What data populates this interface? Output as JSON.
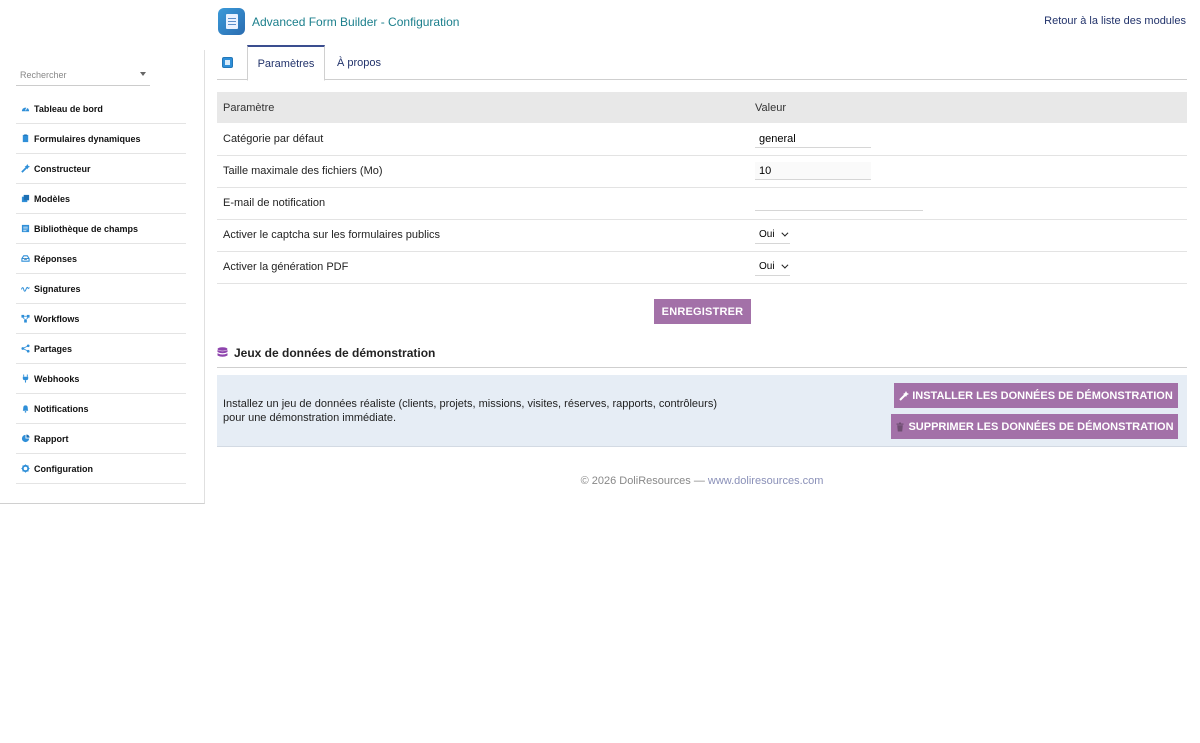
{
  "header": {
    "title": "Advanced Form Builder - Configuration",
    "back_link": "Retour à la liste des modules"
  },
  "sidebar": {
    "search_placeholder": "Rechercher",
    "items": [
      {
        "label": "Tableau de bord",
        "icon": "dashboard-icon"
      },
      {
        "label": "Formulaires dynamiques",
        "icon": "clipboard-icon"
      },
      {
        "label": "Constructeur",
        "icon": "magic-wand-icon"
      },
      {
        "label": "Modèles",
        "icon": "copy-icon"
      },
      {
        "label": "Bibliothèque de champs",
        "icon": "list-icon"
      },
      {
        "label": "Réponses",
        "icon": "inbox-icon"
      },
      {
        "label": "Signatures",
        "icon": "signature-icon"
      },
      {
        "label": "Workflows",
        "icon": "workflow-icon"
      },
      {
        "label": "Partages",
        "icon": "share-icon"
      },
      {
        "label": "Webhooks",
        "icon": "plug-icon"
      },
      {
        "label": "Notifications",
        "icon": "bell-icon"
      },
      {
        "label": "Rapport",
        "icon": "pie-chart-icon"
      },
      {
        "label": "Configuration",
        "icon": "gear-icon"
      }
    ]
  },
  "tabs": {
    "params": "Paramètres",
    "about": "À propos"
  },
  "table": {
    "col_param": "Paramètre",
    "col_value": "Valeur",
    "rows": [
      {
        "label": "Catégorie par défaut",
        "value": "general"
      },
      {
        "label": "Taille maximale des fichiers (Mo)",
        "value": "10"
      },
      {
        "label": "E-mail de notification",
        "value": ""
      },
      {
        "label": "Activer le captcha sur les formulaires publics",
        "value": "Oui"
      },
      {
        "label": "Activer la génération PDF",
        "value": "Oui"
      }
    ]
  },
  "save_label": "ENREGISTRER",
  "demo": {
    "title": "Jeux de données de démonstration",
    "text_line1": "Installez un jeu de données réaliste (clients, projets, missions, visites, réserves, rapports, contrôleurs)",
    "text_line2": "pour une démonstration immédiate.",
    "install_label": "INSTALLER LES DONNÉES DE DÉMONSTRATION",
    "delete_label": "SUPPRIMER LES DONNÉES DE DÉMONSTRATION"
  },
  "footer": {
    "copyright": "© 2026 DoliResources — ",
    "link": "www.doliresources.com"
  },
  "colors": {
    "accent": "#a371a8",
    "title": "#1b7f8c",
    "link": "#22336b",
    "icon": "#2f8fd8"
  }
}
